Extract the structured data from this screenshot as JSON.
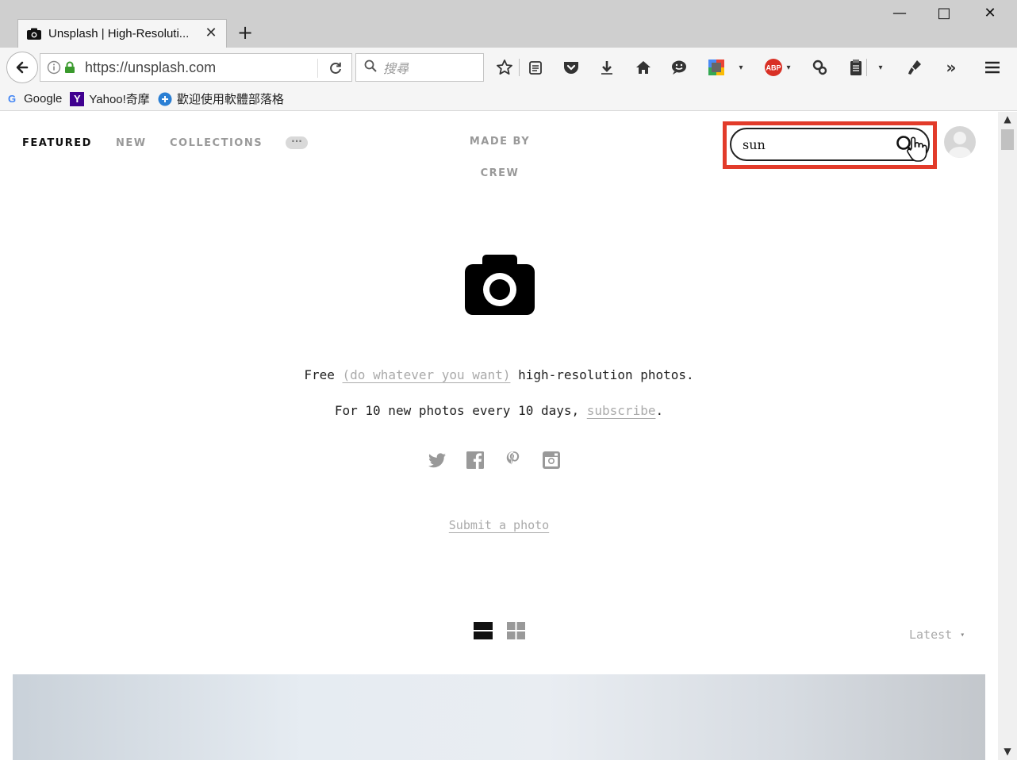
{
  "browser": {
    "tab": {
      "title": "Unsplash | High-Resoluti..."
    },
    "url": "https://unsplash.com",
    "search_placeholder": "搜尋",
    "bookmarks": [
      {
        "label": "Google",
        "icon": "google-icon"
      },
      {
        "label": "Yahoo!奇摩",
        "icon": "yahoo-icon"
      },
      {
        "label": "歡迎使用軟體部落格",
        "icon": "blog-icon"
      }
    ]
  },
  "page": {
    "nav": {
      "featured": "FEATURED",
      "new": "NEW",
      "collections": "COLLECTIONS",
      "more": "···"
    },
    "made_by": {
      "line1": "MADE BY",
      "line2": "CREW"
    },
    "search": {
      "value": "sun"
    },
    "tagline": {
      "line1_start": "Free ",
      "line1_link": "(do whatever you want)",
      "line1_end": " high-resolution photos.",
      "line2_start": "For 10 new photos every 10 days, ",
      "line2_link": "subscribe",
      "line2_end": "."
    },
    "socials": [
      "twitter-icon",
      "facebook-icon",
      "pinterest-icon",
      "instagram-icon"
    ],
    "submit_label": "Submit a photo",
    "sort_label": "Latest"
  },
  "colors": {
    "highlight": "#e23b2a",
    "muted_text": "#999999",
    "link_text": "#aaaaaa"
  }
}
